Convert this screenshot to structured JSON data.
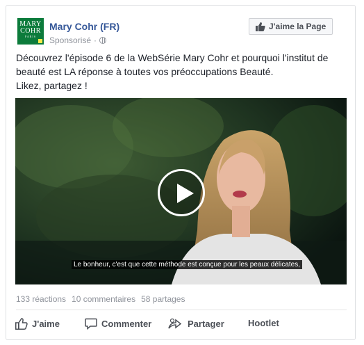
{
  "post": {
    "page_name": "Mary Cohr (FR)",
    "sponsored": "Sponsorisé",
    "separator": "·",
    "like_page_label": "J'aime la Page",
    "logo": {
      "line1": "MARY",
      "line2": "COHR",
      "line3": "PARIS"
    },
    "text_line1": "Découvrez l'épisode 6 de la WebSérie Mary Cohr et pourquoi l'institut de",
    "text_line2": "beauté est LA réponse à toutes vos préoccupations Beauté.",
    "text_line3": "Likez, partagez !"
  },
  "video": {
    "subtitle": "Le bonheur, c'est que cette méthode est conçue pour les peaux délicates,"
  },
  "stats": {
    "reactions": "133 réactions",
    "comments": "10 commentaires",
    "shares": "58 partages"
  },
  "actions": {
    "like": "J'aime",
    "comment": "Commenter",
    "share": "Partager",
    "hootlet": "Hootlet"
  },
  "colors": {
    "brand_green": "#0c7b3b",
    "link_blue": "#365899",
    "meta_gray": "#90949c"
  }
}
